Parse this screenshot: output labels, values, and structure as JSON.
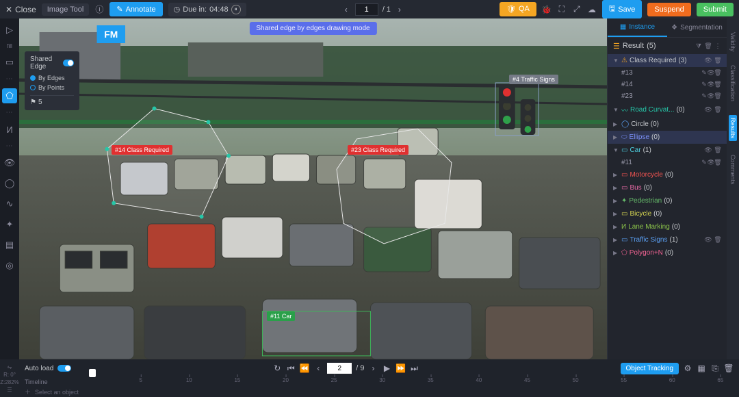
{
  "topbar": {
    "close": "Close",
    "tool_name": "Image Tool",
    "annotate": "Annotate",
    "due_prefix": "Due in:",
    "due_time": "04:48",
    "page_current": "1",
    "page_total": "/ 1",
    "qa": "QA",
    "save": "Save",
    "suspend": "Suspend",
    "submit": "Submit"
  },
  "tooltip": "Shared edge by edges drawing mode",
  "left_tool_label": "fill",
  "popup": {
    "title": "Shared Edge",
    "opt1": "By Edges",
    "opt2": "By Points",
    "point_count": "5"
  },
  "tags": {
    "t14": "#14  Class Required",
    "t23": "#23  Class Required",
    "t11": "#11  Car",
    "t4": "#4  Traffic Signs"
  },
  "right": {
    "tab_instance": "Instance",
    "tab_seg": "Segmentation",
    "result_label": "Result",
    "result_count": "(5)",
    "cats": {
      "class_req": "Class Required",
      "class_req_n": "(3)",
      "road": "Road Curvat...",
      "road_n": "(0)",
      "circle": "Circle",
      "circle_n": "(0)",
      "ellipse": "Ellipse",
      "ellipse_n": "(0)",
      "car": "Car",
      "car_n": "(1)",
      "moto": "Motorcycle",
      "moto_n": "(0)",
      "bus": "Bus",
      "bus_n": "(0)",
      "ped": "Pedestrian",
      "ped_n": "(0)",
      "bike": "Bicycle",
      "bike_n": "(0)",
      "lane": "Lane Marking",
      "lane_n": "(0)",
      "traffic": "Traffic Signs",
      "traffic_n": "(1)",
      "poly": "Polygon+N",
      "poly_n": "(0)"
    },
    "items": {
      "i13": "#13",
      "i14": "#14",
      "i23": "#23",
      "i11": "#11"
    }
  },
  "vside": {
    "validity": "Validity",
    "classif": "Classification",
    "results": "Results",
    "comments": "Comments"
  },
  "bottom": {
    "rot": "R: 0°",
    "zoom": "Z:282%",
    "auto_load": "Auto load",
    "frame": "2",
    "frame_total": "/ 9",
    "obj_track": "Object Tracking",
    "timeline": "Timeline",
    "select": "Select an object",
    "ticks": [
      "5",
      "10",
      "15",
      "20",
      "25",
      "30",
      "35",
      "40",
      "45",
      "50",
      "55",
      "60",
      "65"
    ]
  }
}
